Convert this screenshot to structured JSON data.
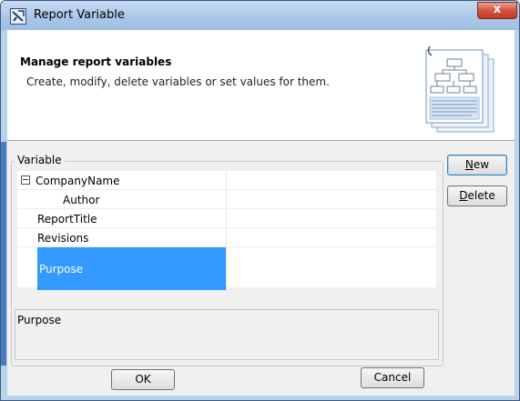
{
  "window": {
    "title": "Report Variable",
    "close_label": "x"
  },
  "header": {
    "title": "Manage report variables",
    "description": "Create, modify, delete variables or set values for them."
  },
  "variables_group": {
    "legend": "Variable",
    "rows": [
      {
        "name": "CompanyName",
        "value": "",
        "expanded": true,
        "level": 0
      },
      {
        "name": "Author",
        "value": "",
        "level": 1
      },
      {
        "name": "ReportTitle",
        "value": "",
        "level": 0
      },
      {
        "name": "Revisions",
        "value": "",
        "level": 0
      },
      {
        "name": "Purpose",
        "value": "",
        "level": 0,
        "selected": true
      }
    ],
    "description_text": "Purpose"
  },
  "side_buttons": {
    "new_prefix": "",
    "new_mnemonic": "N",
    "new_rest": "ew",
    "delete_mnemonic": "D",
    "delete_rest": "elete"
  },
  "footer": {
    "ok_label": "OK",
    "cancel_label": "Cancel"
  },
  "colors": {
    "selection": "#3399ff",
    "title_bar": "#a9c6e8",
    "close_button": "#c23a23"
  }
}
